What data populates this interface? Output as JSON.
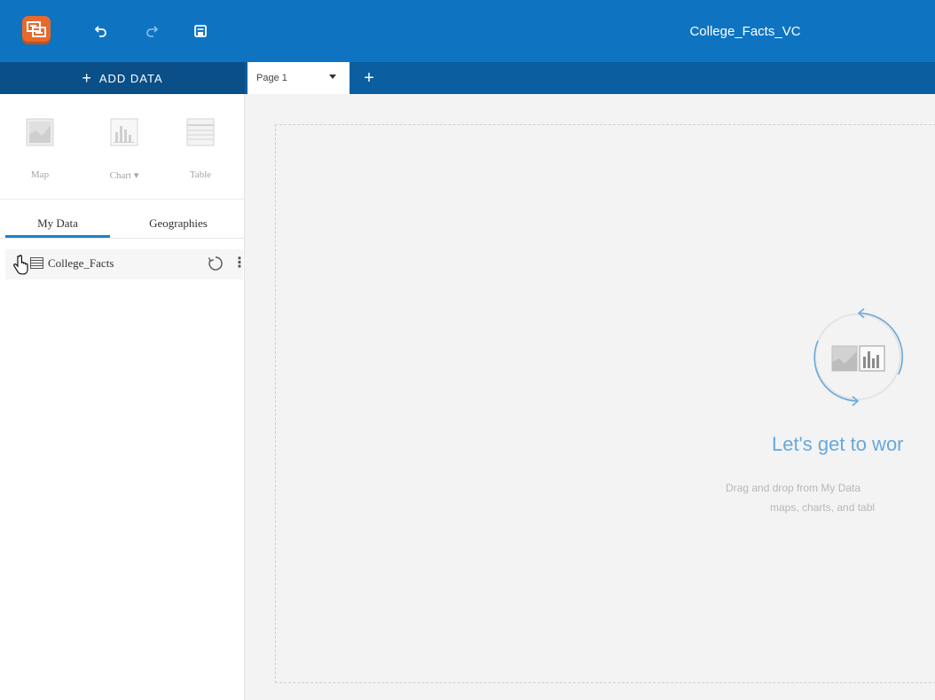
{
  "app": {
    "title": "College_Facts_VC"
  },
  "toolbar": {
    "undo_icon": "undo-icon",
    "redo_icon": "redo-icon",
    "save_icon": "save-icon"
  },
  "sidebar": {
    "add_data_label": "ADD DATA",
    "visualizations": [
      {
        "label": "Map",
        "icon": "map-icon"
      },
      {
        "label": "Chart ▾",
        "icon": "chart-icon"
      },
      {
        "label": "Table",
        "icon": "table-icon"
      }
    ],
    "tabs": [
      {
        "label": "My Data",
        "active": true
      },
      {
        "label": "Geographies",
        "active": false
      }
    ],
    "datasets": [
      {
        "name": "College_Facts"
      }
    ]
  },
  "pages": {
    "tabs": [
      {
        "label": "Page 1"
      }
    ]
  },
  "canvas": {
    "empty_title": "Let's get to wor",
    "empty_message_line1": "Drag and drop from My Data",
    "empty_message_line2": "maps, charts, and tabl"
  },
  "colors": {
    "header_blue": "#0e74c2",
    "subbar_blue": "#0b5ea0",
    "accent": "#1b82cf",
    "logo_orange": "#e8692c"
  }
}
